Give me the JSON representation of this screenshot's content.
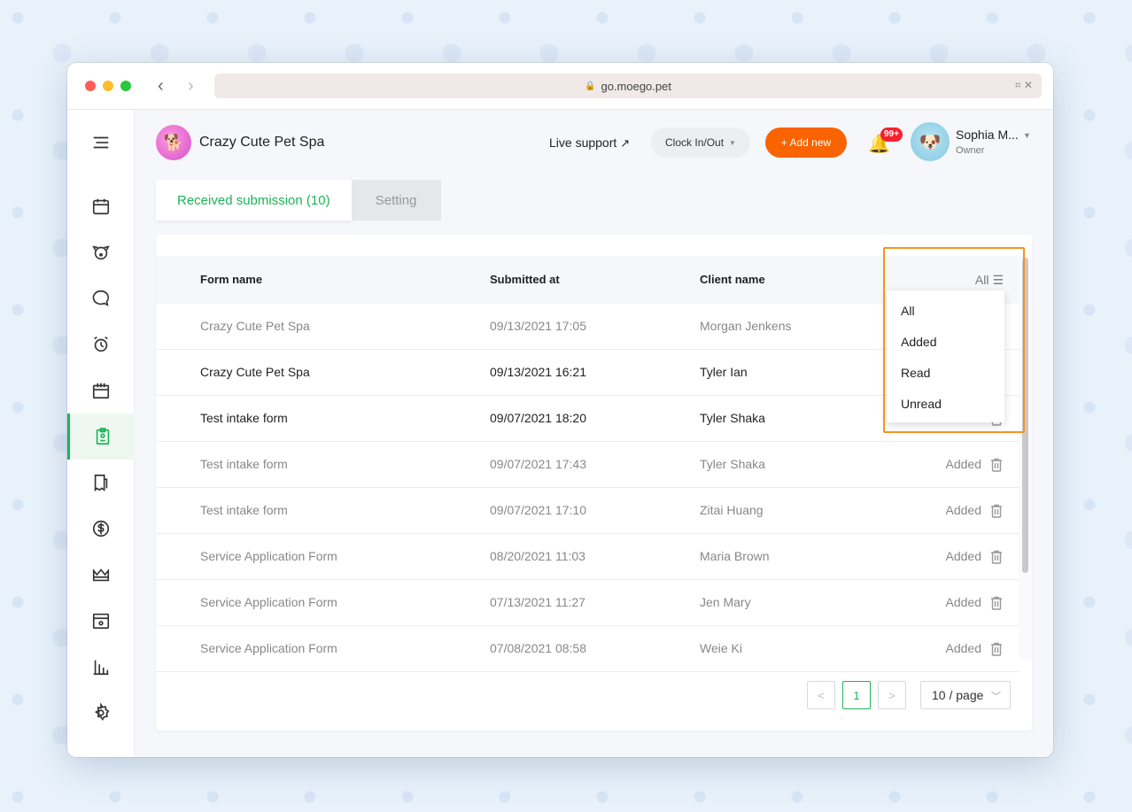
{
  "browser": {
    "url": "go.moego.pet"
  },
  "header": {
    "business_name": "Crazy Cute Pet Spa",
    "live_support": "Live support",
    "clock_label": "Clock In/Out",
    "add_new_label": "+ Add new",
    "notification_badge": "99+",
    "user_name": "Sophia M...",
    "user_role": "Owner"
  },
  "tabs": [
    {
      "label": "Received submission (10)",
      "active": true
    },
    {
      "label": "Setting",
      "active": false
    }
  ],
  "table": {
    "columns": [
      "Form name",
      "Submitted at",
      "Client name"
    ],
    "filter_label": "All",
    "rows": [
      {
        "form": "Crazy Cute Pet Spa",
        "submitted": "09/13/2021 17:05",
        "client": "Morgan Jenkens",
        "status": "",
        "read": true
      },
      {
        "form": "Crazy Cute Pet Spa",
        "submitted": "09/13/2021 16:21",
        "client": "Tyler Ian",
        "status": "",
        "read": false
      },
      {
        "form": "Test intake form",
        "submitted": "09/07/2021 18:20",
        "client": "Tyler Shaka",
        "status": "",
        "read": false
      },
      {
        "form": "Test intake form",
        "submitted": "09/07/2021 17:43",
        "client": "Tyler Shaka",
        "status": "Added",
        "read": true
      },
      {
        "form": "Test intake form",
        "submitted": "09/07/2021 17:10",
        "client": "Zitai Huang",
        "status": "Added",
        "read": true
      },
      {
        "form": "Service Application Form",
        "submitted": "08/20/2021 11:03",
        "client": "Maria Brown",
        "status": "Added",
        "read": true
      },
      {
        "form": "Service Application Form",
        "submitted": "07/13/2021 11:27",
        "client": "Jen Mary",
        "status": "Added",
        "read": true
      },
      {
        "form": "Service Application Form",
        "submitted": "07/08/2021 08:58",
        "client": "Weie Ki",
        "status": "Added",
        "read": true
      }
    ]
  },
  "filter_dropdown": {
    "options": [
      "All",
      "Added",
      "Read",
      "Unread"
    ]
  },
  "pagination": {
    "prev": "<",
    "current_page": "1",
    "next": ">",
    "page_size": "10 / page"
  },
  "sidebar": {
    "items": [
      "menu-icon",
      "calendar-icon",
      "pet-icon",
      "message-icon",
      "alarm-icon",
      "schedule-icon",
      "intake-form-icon",
      "agreement-icon",
      "dollar-icon",
      "crown-icon",
      "calendar-box-icon",
      "reports-icon",
      "settings-icon"
    ],
    "active": "intake-form-icon"
  },
  "colors": {
    "accent": "#1fb35a",
    "brand": "#f96300",
    "highlight": "#f7931e"
  }
}
